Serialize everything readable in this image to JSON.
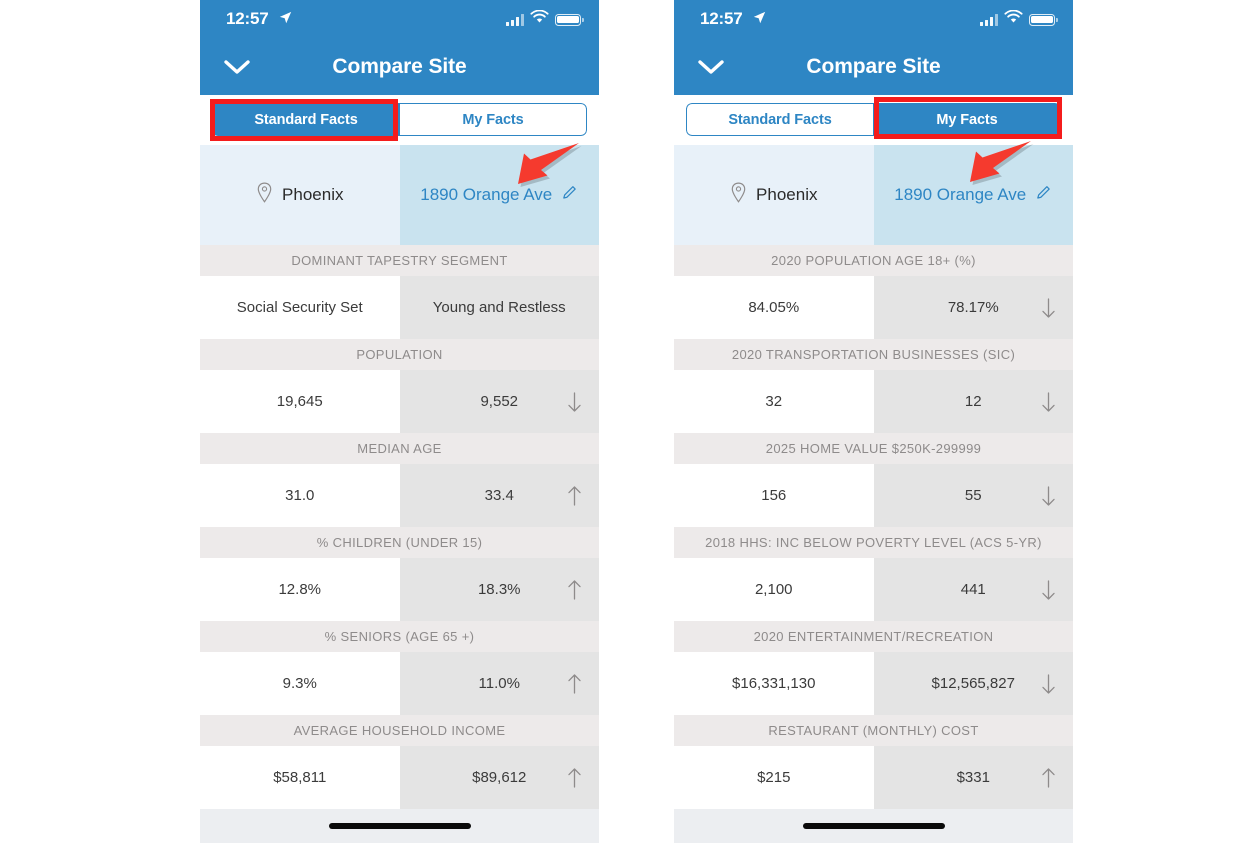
{
  "phones": [
    {
      "id": "left",
      "status_bar": {
        "time": "12:57",
        "location_icon": "location-arrow-icon",
        "signal_icon": "cellular-signal-icon",
        "wifi_icon": "wifi-icon",
        "battery_icon": "battery-full-icon"
      },
      "nav": {
        "back_icon": "chevron-down-icon",
        "title": "Compare Site"
      },
      "tabs": [
        {
          "label": "Standard Facts",
          "active": true
        },
        {
          "label": "My Facts",
          "active": false
        }
      ],
      "highlighted_tab": "Standard Facts",
      "sites": [
        {
          "name": "Phoenix",
          "icon": "map-pin-icon",
          "editable": false
        },
        {
          "name": "1890 Orange Ave",
          "icon": "pencil-icon",
          "editable": true
        }
      ],
      "facts": [
        {
          "label": "DOMINANT TAPESTRY SEGMENT",
          "a": "Social Security Set",
          "b": "Young and Restless",
          "trend": ""
        },
        {
          "label": "POPULATION",
          "a": "19,645",
          "b": "9,552",
          "trend": "down"
        },
        {
          "label": "MEDIAN AGE",
          "a": "31.0",
          "b": "33.4",
          "trend": "up"
        },
        {
          "label": "% CHILDREN (UNDER 15)",
          "a": "12.8%",
          "b": "18.3%",
          "trend": "up"
        },
        {
          "label": "% SENIORS (AGE 65 +)",
          "a": "9.3%",
          "b": "11.0%",
          "trend": "up"
        },
        {
          "label": "AVERAGE HOUSEHOLD INCOME",
          "a": "$58,811",
          "b": "$89,612",
          "trend": "up"
        }
      ]
    },
    {
      "id": "right",
      "status_bar": {
        "time": "12:57",
        "location_icon": "location-arrow-icon",
        "signal_icon": "cellular-signal-icon",
        "wifi_icon": "wifi-icon",
        "battery_icon": "battery-full-icon"
      },
      "nav": {
        "back_icon": "chevron-down-icon",
        "title": "Compare Site"
      },
      "tabs": [
        {
          "label": "Standard Facts",
          "active": false
        },
        {
          "label": "My Facts",
          "active": true
        }
      ],
      "highlighted_tab": "My Facts",
      "sites": [
        {
          "name": "Phoenix",
          "icon": "map-pin-icon",
          "editable": false
        },
        {
          "name": "1890 Orange Ave",
          "icon": "pencil-icon",
          "editable": true
        }
      ],
      "facts": [
        {
          "label": "2020 POPULATION AGE 18+ (%)",
          "a": "84.05%",
          "b": "78.17%",
          "trend": "down"
        },
        {
          "label": "2020 TRANSPORTATION BUSINESSES (SIC)",
          "a": "32",
          "b": "12",
          "trend": "down"
        },
        {
          "label": "2025 HOME VALUE $250K-299999",
          "a": "156",
          "b": "55",
          "trend": "down"
        },
        {
          "label": "2018 HHS: INC BELOW POVERTY LEVEL (ACS 5-YR)",
          "a": "2,100",
          "b": "441",
          "trend": "down"
        },
        {
          "label": "2020 ENTERTAINMENT/RECREATION",
          "a": "$16,331,130",
          "b": "$12,565,827",
          "trend": "down"
        },
        {
          "label": "RESTAURANT (MONTHLY) COST",
          "a": "$215",
          "b": "$331",
          "trend": "up"
        }
      ]
    }
  ],
  "annotations": {
    "highlight_color": "#f41c1c",
    "arrow_color": "#f53a2e",
    "arrow_target": "1890 Orange Ave",
    "arrow_icon": "red-callout-arrow"
  },
  "colors": {
    "brand_blue": "#2e86c4",
    "site_cell_a": "#e8f1f9",
    "site_cell_b": "#c9e3ef",
    "label_row": "#edeaea",
    "value_cell_b": "#e4e4e4",
    "text_muted": "#8e8b8b"
  }
}
